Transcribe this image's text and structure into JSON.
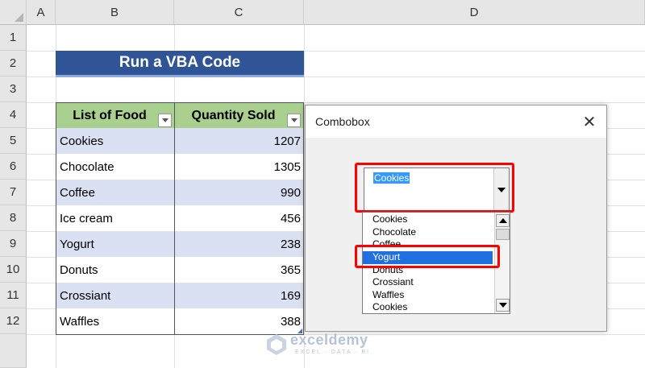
{
  "sheet": {
    "columns": [
      "A",
      "B",
      "C",
      "D"
    ],
    "rows": [
      "1",
      "2",
      "3",
      "4",
      "5",
      "6",
      "7",
      "8",
      "9",
      "10",
      "11",
      "12"
    ],
    "title": "Run a VBA Code",
    "headers": {
      "food": "List of Food",
      "qty": "Quantity Sold"
    },
    "data": [
      {
        "food": "Cookies",
        "qty": "1207"
      },
      {
        "food": "Chocolate",
        "qty": "1305"
      },
      {
        "food": "Coffee",
        "qty": "990"
      },
      {
        "food": "Ice cream",
        "qty": "456"
      },
      {
        "food": "Yogurt",
        "qty": "238"
      },
      {
        "food": "Donuts",
        "qty": "365"
      },
      {
        "food": "Crossiant",
        "qty": "169"
      },
      {
        "food": "Waffles",
        "qty": "388"
      }
    ]
  },
  "dialog": {
    "title": "Combobox",
    "close": "✕",
    "combo_value": "Cookies",
    "list": [
      "Cookies",
      "Chocolate",
      "Coffee",
      "Yogurt",
      "Donuts",
      "Crossiant",
      "Waffles",
      "Cookies"
    ],
    "selected_index": 3
  },
  "watermark": {
    "name": "exceldemy",
    "tagline": "EXCEL · DATA · BI"
  },
  "colors": {
    "title_bg": "#2f5597",
    "header_bg": "#a9d08e",
    "band": "#d9e1f2",
    "highlight": "#ff0000",
    "selection": "#1f6fe0"
  }
}
